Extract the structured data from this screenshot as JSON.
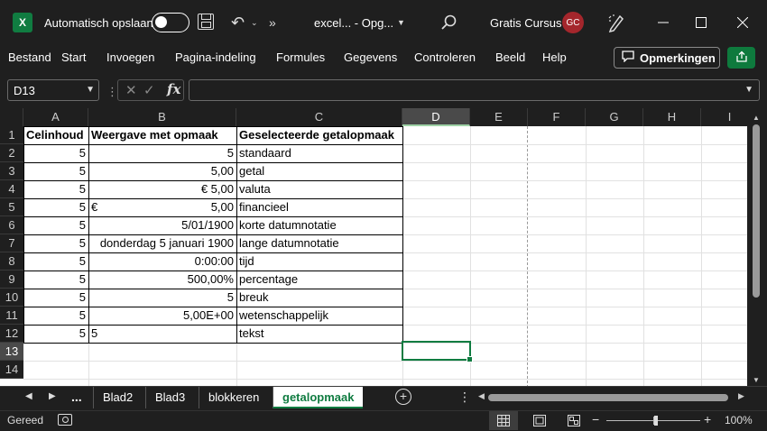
{
  "titlebar": {
    "app_icon": "excel-icon",
    "app_letter": "X",
    "autosave_label": "Automatisch opslaan",
    "autosave_on": false,
    "filename": "excel... - Opg...",
    "user_name": "Gratis Cursus",
    "avatar_initials": "GC",
    "avatar_color": "#a4262c"
  },
  "menu": {
    "items": [
      "Bestand",
      "Start",
      "Invoegen",
      "Pagina-indeling",
      "Formules",
      "Gegevens",
      "Controleren",
      "Beeld",
      "Help"
    ],
    "comments_label": "Opmerkingen",
    "accent": "#107c41"
  },
  "formula_bar": {
    "name_box": "D13",
    "fx": "fx",
    "formula": ""
  },
  "sheet": {
    "columns": [
      "A",
      "B",
      "C",
      "D",
      "E",
      "F",
      "G",
      "H",
      "I"
    ],
    "rows": [
      "1",
      "2",
      "3",
      "4",
      "5",
      "6",
      "7",
      "8",
      "9",
      "10",
      "11",
      "12",
      "13",
      "14"
    ],
    "selected_column": "D",
    "selected_row": "13",
    "active_cell": "D13",
    "header": [
      "Celinhoud",
      "Weergave met opmaak",
      "Geselecteerde getalopmaak"
    ],
    "data": [
      [
        "5",
        "5",
        "standaard"
      ],
      [
        "5",
        "5,00",
        "getal"
      ],
      [
        "5",
        "€ 5,00",
        "valuta"
      ],
      [
        "5",
        "€|5,00",
        "financieel"
      ],
      [
        "5",
        "5/01/1900",
        "korte datumnotatie"
      ],
      [
        "5",
        "donderdag 5 januari 1900",
        "lange datumnotatie"
      ],
      [
        "5",
        "0:00:00",
        "tijd"
      ],
      [
        "5",
        "500,00%",
        "percentage"
      ],
      [
        "5",
        "5",
        "breuk"
      ],
      [
        "5",
        "5,00E+00",
        "wetenschappelijk"
      ],
      [
        "5",
        "5",
        "tekst"
      ]
    ],
    "financial_symbol": "€",
    "financial_value": "5,00"
  },
  "tabs": {
    "ellipsis": "...",
    "items": [
      "Blad2",
      "Blad3",
      "blokkeren",
      "getalopmaak"
    ],
    "active": "getalopmaak"
  },
  "status": {
    "ready": "Gereed",
    "zoom": "100%"
  }
}
